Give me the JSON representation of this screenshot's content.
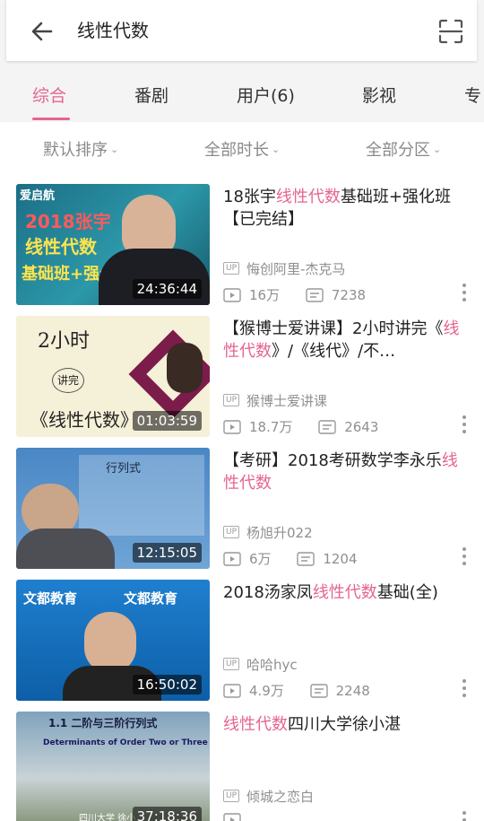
{
  "search": {
    "query": "线性代数"
  },
  "tabs": [
    {
      "label": "综合",
      "active": true
    },
    {
      "label": "番剧",
      "active": false
    },
    {
      "label": "用户(6)",
      "active": false
    },
    {
      "label": "影视",
      "active": false
    },
    {
      "label": "专",
      "active": false
    }
  ],
  "filters": [
    {
      "label": "默认排序"
    },
    {
      "label": "全部时长"
    },
    {
      "label": "全部分区"
    }
  ],
  "colors": {
    "accent": "#e5658f",
    "meta": "#8f8f8f"
  },
  "up_badge": "UP",
  "results": [
    {
      "title_pre": "18张宇",
      "title_hl": "线性代数",
      "title_post": "基础班+强化班【已完结】",
      "duration": "24:36:44",
      "uploader": "悔创阿里-杰克马",
      "views": "16万",
      "danmaku": "7238",
      "thumb_text": {
        "logo": "爱启航",
        "line1": "2018张宇",
        "line2": "线性代数",
        "line3": "基础班+强化班"
      }
    },
    {
      "title_pre": "【猴博士爱讲课】2小时讲完《",
      "title_hl": "线性代数",
      "title_post": "》/《线代》/不…",
      "duration": "01:03:59",
      "uploader": "猴博士爱讲课",
      "views": "18.7万",
      "danmaku": "2643",
      "thumb_text": {
        "line1": "2小时",
        "line2": "讲完",
        "line3": "《线性代数》"
      }
    },
    {
      "title_pre": "【考研】2018考研数学李永乐",
      "title_hl": "线性代数",
      "title_post": "",
      "duration": "12:15:05",
      "uploader": "杨旭升022",
      "views": "6万",
      "danmaku": "1204",
      "thumb_text": {
        "line1": "行列式"
      }
    },
    {
      "title_pre": "2018汤家凤",
      "title_hl": "线性代数",
      "title_post": "基础(全)",
      "duration": "16:50:02",
      "uploader": "哈哈hyc",
      "views": "4.9万",
      "danmaku": "2248",
      "thumb_text": {
        "logo": "文都教育"
      }
    },
    {
      "title_pre": "",
      "title_hl": "线性代数",
      "title_post": "四川大学徐小湛",
      "duration": "37:18:36",
      "uploader": "倾城之恋白",
      "views": "",
      "danmaku": "",
      "thumb_text": {
        "line1": "1.1 二阶与三阶行列式",
        "line2": "Determinants of Order Two or Three",
        "line3": "四川大学 徐小"
      }
    }
  ]
}
